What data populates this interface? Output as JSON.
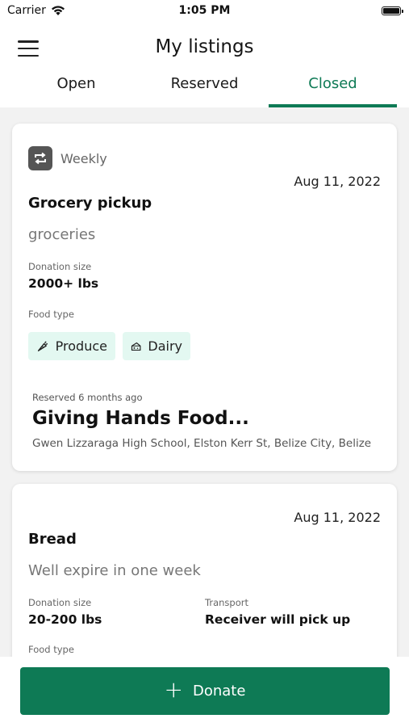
{
  "status_bar": {
    "carrier": "Carrier",
    "time": "1:05 PM"
  },
  "header": {
    "title": "My listings",
    "tabs": [
      {
        "label": "Open",
        "active": false
      },
      {
        "label": "Reserved",
        "active": false
      },
      {
        "label": "Closed",
        "active": true
      }
    ]
  },
  "listings": [
    {
      "frequency": "Weekly",
      "date": "Aug 11, 2022",
      "title": "Grocery pickup",
      "description": "groceries",
      "donation_size_label": "Donation size",
      "donation_size": "2000+ lbs",
      "food_type_label": "Food type",
      "food_types": [
        {
          "label": "Produce",
          "icon": "carrot-icon"
        },
        {
          "label": "Dairy",
          "icon": "cheese-icon"
        }
      ],
      "reserved_time": "Reserved 6 months ago",
      "reserved_by": "Giving Hands Food...",
      "address": "Gwen Lizzaraga High School, Elston Kerr St, Belize City, Belize"
    },
    {
      "date": "Aug 11, 2022",
      "title": "Bread",
      "description": "Well expire in one week",
      "donation_size_label": "Donation size",
      "donation_size": "20-200 lbs",
      "transport_label": "Transport",
      "transport": "Receiver will pick up",
      "food_type_label": "Food type"
    }
  ],
  "donate_button": {
    "label": "Donate",
    "icon": "plus-icon"
  },
  "colors": {
    "accent": "#0e7a55",
    "chip_bg": "#e3f8f1",
    "page_bg": "#f2f2f2"
  }
}
